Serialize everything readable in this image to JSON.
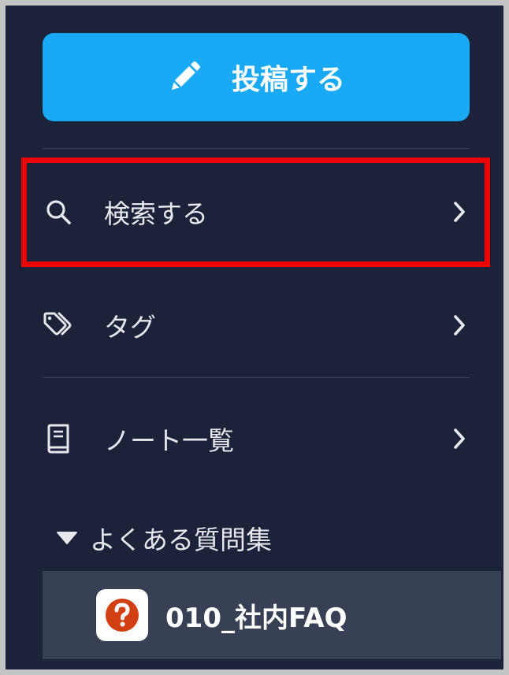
{
  "post_button": {
    "label": "投稿する",
    "icon": "pencil-icon",
    "color": "#19a9f5"
  },
  "nav": {
    "items": [
      {
        "label": "検索する",
        "icon": "search-icon"
      },
      {
        "label": "タグ",
        "icon": "tag-icon"
      },
      {
        "label": "ノート一覧",
        "icon": "notebook-icon"
      }
    ]
  },
  "folder": {
    "label": "よくある質問集",
    "expanded": true,
    "items": [
      {
        "label": "010_社内FAQ",
        "icon": "question-mark-icon",
        "icon_color": "#d13f12"
      }
    ]
  },
  "colors": {
    "background": "#1b2239",
    "highlight": "#ee0000",
    "selected_row": "#384055"
  }
}
